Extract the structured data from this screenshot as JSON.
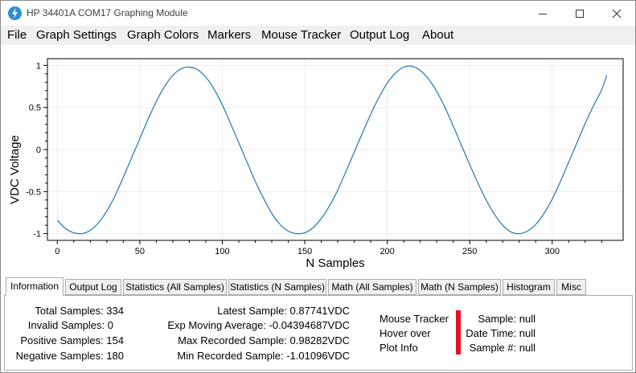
{
  "window": {
    "title": "HP 34401A COM17 Graphing Module",
    "accent_icon_color": "#2a8fd6"
  },
  "menu": [
    "File",
    "Graph Settings",
    "Graph Colors",
    "Markers",
    "Mouse Tracker",
    "Output Log",
    "About"
  ],
  "chart_data": {
    "type": "line",
    "xlabel": "N Samples",
    "ylabel": "VDC Voltage",
    "xlim": [
      -6,
      343
    ],
    "ylim": [
      -1.08,
      1.08
    ],
    "x_ticks": [
      0,
      50,
      100,
      150,
      200,
      250,
      300
    ],
    "y_ticks": [
      1,
      0.5,
      0,
      -0.5,
      -1
    ],
    "y_tick_labels": [
      "1",
      "0.5",
      "0",
      "-0.5",
      "-1"
    ],
    "grid": true,
    "line_color": "#1f77b4",
    "series": [
      {
        "x": [
          0,
          5,
          10,
          15,
          20,
          25,
          30,
          35,
          40,
          45,
          50,
          55,
          60,
          65,
          70,
          75,
          80,
          85,
          90,
          95,
          100,
          105,
          110,
          115,
          120,
          125,
          130,
          135,
          140,
          145,
          150,
          155,
          160,
          165,
          170,
          175,
          180,
          185,
          190,
          195,
          200,
          205,
          210,
          215,
          220,
          225,
          230,
          235,
          240,
          245,
          250,
          255,
          260,
          265,
          270,
          275,
          280,
          285,
          290,
          295,
          300,
          305,
          310,
          315,
          320,
          325,
          330,
          333
        ],
        "y": [
          -0.84,
          -0.94,
          -0.99,
          -1.0,
          -0.96,
          -0.87,
          -0.73,
          -0.55,
          -0.33,
          -0.1,
          0.13,
          0.36,
          0.57,
          0.75,
          0.88,
          0.96,
          0.98,
          0.95,
          0.86,
          0.72,
          0.53,
          0.31,
          0.08,
          -0.15,
          -0.38,
          -0.58,
          -0.76,
          -0.89,
          -0.97,
          -1.0,
          -0.99,
          -0.93,
          -0.82,
          -0.67,
          -0.48,
          -0.26,
          -0.03,
          0.2,
          0.42,
          0.62,
          0.79,
          0.91,
          0.98,
          0.99,
          0.94,
          0.84,
          0.69,
          0.5,
          0.28,
          0.05,
          -0.18,
          -0.4,
          -0.6,
          -0.77,
          -0.9,
          -0.98,
          -1.0,
          -0.97,
          -0.89,
          -0.76,
          -0.59,
          -0.38,
          -0.15,
          0.08,
          0.31,
          0.52,
          0.71,
          0.88
        ]
      }
    ]
  },
  "tabs": [
    {
      "label": "Information",
      "active": true
    },
    {
      "label": "Output Log"
    },
    {
      "label": "Statistics (All Samples)"
    },
    {
      "label": "Statistics (N Samples)"
    },
    {
      "label": "Math (All Samples)"
    },
    {
      "label": "Math (N Samples)"
    },
    {
      "label": "Histogram"
    },
    {
      "label": "Misc"
    }
  ],
  "info": {
    "total_samples": "Total Samples: 334",
    "invalid_samples": "Invalid Samples: 0",
    "positive_samples": "Positive Samples: 154",
    "negative_samples": "Negative Samples: 180",
    "latest_sample": "Latest Sample: 0.87741VDC",
    "exp_moving_average": "Exp Moving Average: -0.04394687VDC",
    "max_recorded": "Max Recorded Sample: 0.98282VDC",
    "min_recorded": "Min Recorded Sample: -1.01096VDC",
    "mouse_tracker_1": "Mouse Tracker",
    "mouse_tracker_2": "Hover over",
    "mouse_tracker_3": "Plot Info",
    "tracker_sample": "Sample: null",
    "tracker_datetime": "Date Time: null",
    "tracker_sample_num": "Sample #: null",
    "tracker_color": "#e81123"
  }
}
